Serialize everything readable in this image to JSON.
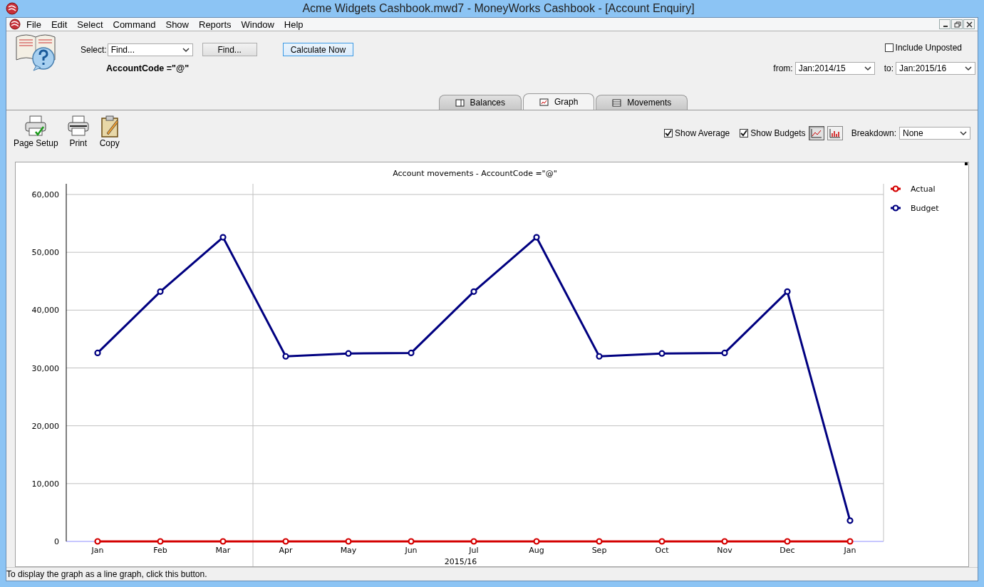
{
  "window": {
    "title": "Acme Widgets Cashbook.mwd7 - MoneyWorks Cashbook - [Account Enquiry]"
  },
  "menu": [
    "File",
    "Edit",
    "Select",
    "Command",
    "Show",
    "Reports",
    "Window",
    "Help"
  ],
  "query": {
    "select_label": "Select:",
    "select_value": "Find...",
    "find_button": "Find...",
    "calculate_button": "Calculate Now",
    "criteria": "AccountCode =\"@\"",
    "include_unposted": {
      "label": "Include Unposted",
      "checked": false
    },
    "from": {
      "label": "from:",
      "value": "Jan:2014/15"
    },
    "to": {
      "label": "to:",
      "value": "Jan:2015/16"
    }
  },
  "tabs": [
    {
      "label": "Balances",
      "kind": "balances",
      "selected": false
    },
    {
      "label": "Graph",
      "kind": "graph",
      "selected": true
    },
    {
      "label": "Movements",
      "kind": "movements",
      "selected": false
    }
  ],
  "toolbar": [
    {
      "label": "Page Setup",
      "kind": "page-setup"
    },
    {
      "label": "Print",
      "kind": "print"
    },
    {
      "label": "Copy",
      "kind": "copy"
    }
  ],
  "options": {
    "show_average": {
      "label": "Show Average",
      "checked": true
    },
    "show_budgets": {
      "label": "Show Budgets",
      "checked": true
    },
    "chart_types": [
      {
        "kind": "line",
        "selected": true
      },
      {
        "kind": "bar",
        "selected": false
      }
    ],
    "breakdown": {
      "label": "Breakdown:",
      "value": "None"
    }
  },
  "chart": {
    "chart_data": {
      "type": "line",
      "title": "Account movements - AccountCode =\"@\"",
      "xlabel": "2015/16",
      "categories": [
        "Jan",
        "Feb",
        "Mar",
        "Apr",
        "May",
        "Jun",
        "Jul",
        "Aug",
        "Sep",
        "Oct",
        "Nov",
        "Dec",
        "Jan"
      ],
      "series": [
        {
          "name": "Actual",
          "color": "#d40000",
          "marker": "circle",
          "values": [
            0,
            0,
            0,
            0,
            0,
            0,
            0,
            0,
            0,
            0,
            0,
            0,
            0
          ]
        },
        {
          "name": "Budget",
          "color": "#000080",
          "marker": "circle",
          "values": [
            32600,
            43200,
            52600,
            32000,
            32500,
            32600,
            43200,
            52600,
            32000,
            32500,
            32600,
            43200,
            3600
          ]
        }
      ],
      "ylim": [
        0,
        60000
      ],
      "grid": true,
      "legend": true,
      "yticks": [
        {
          "value": 0,
          "label": "0"
        },
        {
          "value": 10000,
          "label": "10,000"
        },
        {
          "value": 20000,
          "label": "20,000"
        },
        {
          "value": 30000,
          "label": "30,000"
        },
        {
          "value": 40000,
          "label": "40,000"
        },
        {
          "value": 50000,
          "label": "50,000"
        },
        {
          "value": 60000,
          "label": "60,000"
        }
      ]
    }
  },
  "status_bar": "To display the graph as a line graph, click this button."
}
